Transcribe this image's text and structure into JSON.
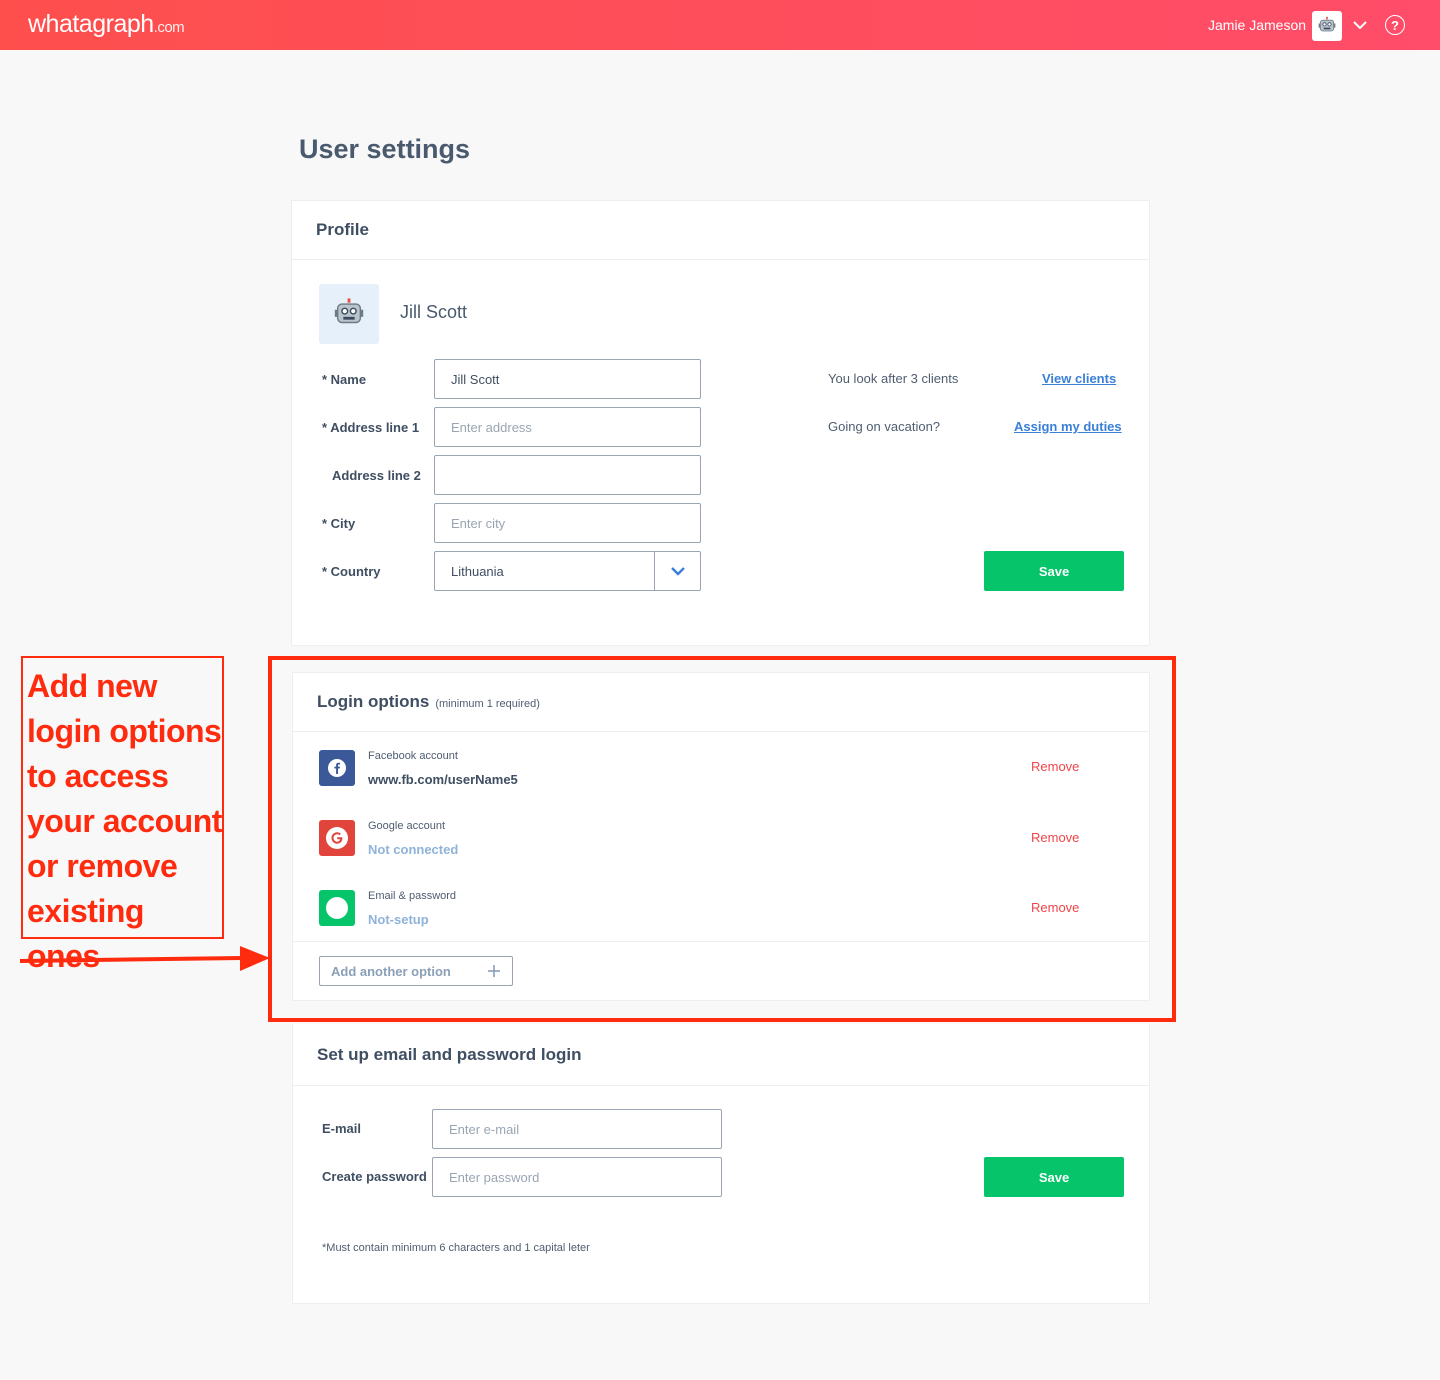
{
  "topbar": {
    "logo_main": "whatagraph",
    "logo_suffix": ".com",
    "user_name": "Jamie Jameson",
    "help_glyph": "?"
  },
  "page": {
    "title": "User settings"
  },
  "profile": {
    "header": "Profile",
    "display_name": "Jill Scott",
    "avatar_emoji": "🤖",
    "fields": {
      "name_label": "* Name",
      "name_value": "Jill Scott",
      "address1_label": "* Address line 1",
      "address1_placeholder": "Enter address",
      "address2_label": "Address line 2",
      "address2_value": "",
      "city_label": "* City",
      "city_placeholder": "Enter city",
      "country_label": "* Country",
      "country_value": "Lithuania"
    },
    "clients_text": "You look after 3 clients",
    "view_clients_link": "View clients",
    "vacation_text": "Going on vacation?",
    "assign_duties_link": "Assign my duties",
    "save_label": "Save"
  },
  "login_options": {
    "header": "Login options",
    "header_sub": "(minimum 1 required)",
    "items": [
      {
        "title": "Facebook account",
        "value": "www.fb.com/userName5",
        "action": "Remove"
      },
      {
        "title": "Google account",
        "value": "Not connected",
        "action": "Remove"
      },
      {
        "title": "Email & password",
        "value": "Not-setup",
        "action": "Remove"
      }
    ],
    "add_label": "Add another option"
  },
  "email_setup": {
    "header": "Set up email and password login",
    "email_label": "E-mail",
    "email_placeholder": "Enter e-mail",
    "password_label": "Create password",
    "password_placeholder": "Enter password",
    "save_label": "Save",
    "hint": "*Must contain minimum 6 characters and 1 capital leter"
  },
  "annotation": {
    "text": "Add new login options to access your account or remove existing ones"
  },
  "colors": {
    "topbar": "#fe4f4d",
    "save_green": "#06c46a",
    "link_blue": "#3a7fd6",
    "remove_red": "#f0454a",
    "annotation_red": "#ff2b0f",
    "facebook": "#3b5998",
    "google": "#e0443a",
    "email": "#06c46a"
  }
}
